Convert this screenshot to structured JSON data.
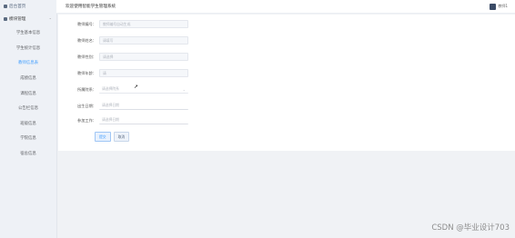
{
  "sidebar": {
    "home_label": "后台首页",
    "group_label": "模块管理",
    "items": [
      {
        "label": "学生基本信息"
      },
      {
        "label": "学生统计信息"
      },
      {
        "label": "教师信息表"
      },
      {
        "label": "成绩信息"
      },
      {
        "label": "课程信息"
      },
      {
        "label": "公告栏信息"
      },
      {
        "label": "班级信息"
      },
      {
        "label": "学院信息"
      },
      {
        "label": "宿舍信息"
      }
    ]
  },
  "header": {
    "title": "欢迎使用智能学生管理系统",
    "user": "教师1"
  },
  "form": {
    "fields": [
      {
        "label": "教师编号：",
        "value": "教师编号自动生成"
      },
      {
        "label": "教师姓名：",
        "value": "请填写"
      },
      {
        "label": "教师性别：",
        "value": "请选择"
      },
      {
        "label": "教师年龄：",
        "value": "请"
      },
      {
        "label": "所属院系：",
        "value": "请选择院系"
      },
      {
        "label": "出生日期：",
        "value": "请选择日期"
      },
      {
        "label": "参加工作：",
        "value": "请选择日期"
      }
    ],
    "submit_label": "提交",
    "cancel_label": "取消"
  },
  "watermark": "CSDN @毕业设计703"
}
